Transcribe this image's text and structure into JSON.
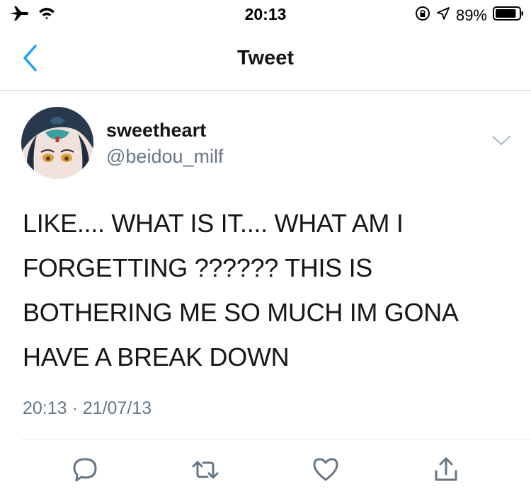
{
  "status_bar": {
    "time": "20:13",
    "battery_percent": "89%",
    "battery_level": 0.89,
    "icons": [
      "airplane-icon",
      "wifi-icon",
      "orientation-lock-icon",
      "location-icon",
      "battery-icon"
    ]
  },
  "nav": {
    "title": "Tweet",
    "back_icon": "chevron-left-icon"
  },
  "tweet": {
    "author_name": "sweetheart",
    "author_handle": "@beidou_milf",
    "text_lines": [
      "LIKE.... WHAT IS IT.... WHAT AM I",
      "FORGETTING ?????? THIS IS",
      "BOTHERING ME SO MUCH IM GONA",
      "HAVE A BREAK DOWN"
    ],
    "meta": "20:13 · 21/07/13"
  },
  "actions": [
    "reply-icon",
    "retweet-icon",
    "like-icon",
    "share-icon"
  ],
  "colors": {
    "accent": "#1da1f2",
    "text": "#14171a",
    "secondary": "#657786",
    "divider": "#e1e8ed"
  }
}
